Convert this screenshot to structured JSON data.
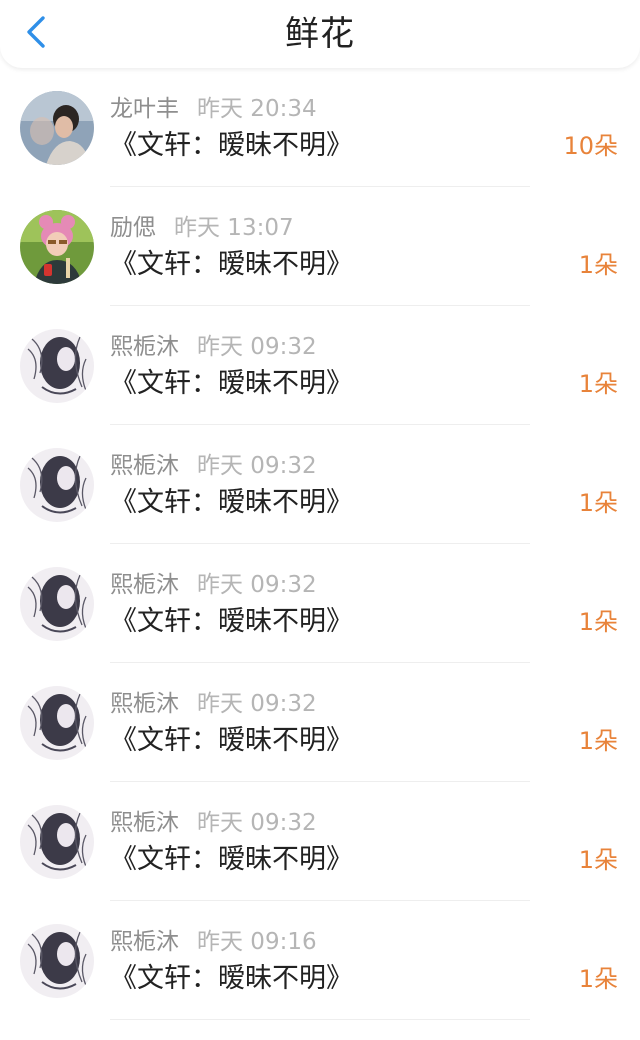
{
  "header": {
    "title": "鲜花",
    "back_icon": "chevron-left-icon",
    "accent": "#2f8fe8"
  },
  "colors": {
    "count": "#e8833a",
    "name": "#8e8e8e",
    "time": "#b5b5b5"
  },
  "records": [
    {
      "user": "龙叶丰",
      "time": "昨天 20:34",
      "work": "《文轩：暧昧不明》",
      "count": "10朵",
      "avatar": "portrait-avatar"
    },
    {
      "user": "励偲",
      "time": "昨天 13:07",
      "work": "《文轩：暧昧不明》",
      "count": "1朵",
      "avatar": "pink-hair-avatar"
    },
    {
      "user": "熙栀沐",
      "time": "昨天 09:32",
      "work": "《文轩：暧昧不明》",
      "count": "1朵",
      "avatar": "sketch-avatar"
    },
    {
      "user": "熙栀沐",
      "time": "昨天 09:32",
      "work": "《文轩：暧昧不明》",
      "count": "1朵",
      "avatar": "sketch-avatar"
    },
    {
      "user": "熙栀沐",
      "time": "昨天 09:32",
      "work": "《文轩：暧昧不明》",
      "count": "1朵",
      "avatar": "sketch-avatar"
    },
    {
      "user": "熙栀沐",
      "time": "昨天 09:32",
      "work": "《文轩：暧昧不明》",
      "count": "1朵",
      "avatar": "sketch-avatar"
    },
    {
      "user": "熙栀沐",
      "time": "昨天 09:32",
      "work": "《文轩：暧昧不明》",
      "count": "1朵",
      "avatar": "sketch-avatar"
    },
    {
      "user": "熙栀沐",
      "time": "昨天 09:16",
      "work": "《文轩：暧昧不明》",
      "count": "1朵",
      "avatar": "sketch-avatar"
    }
  ]
}
